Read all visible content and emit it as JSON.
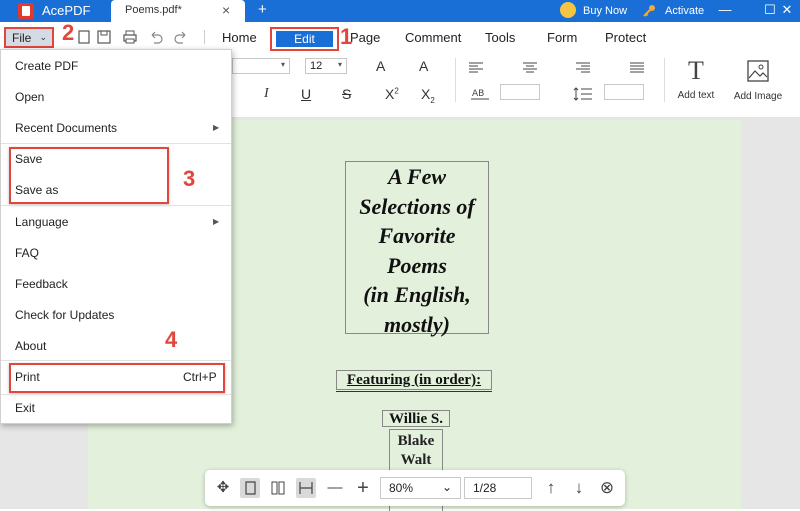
{
  "titlebar": {
    "app_name": "AcePDF",
    "doc_tab": "Poems.pdf*",
    "doc_tab_close": "×",
    "new_tab": "+",
    "buy_now": "Buy Now",
    "activate": "Activate",
    "minimize": "—",
    "maximize": "☐",
    "close": "✕",
    "colors": {
      "titlebar": "#1a6fd6",
      "annotation": "#e0463a"
    }
  },
  "menubar": {
    "file_label": "File",
    "file_caret": "⌄",
    "tabs": [
      "Home",
      "Edit",
      "Page",
      "Comment",
      "Tools",
      "Form",
      "Protect"
    ],
    "active_tab": "Edit",
    "quick_icons": [
      "new-doc-icon",
      "save-icon",
      "print-icon",
      "undo-icon",
      "redo-icon"
    ]
  },
  "annotations": [
    "1",
    "2",
    "3",
    "4"
  ],
  "toolbar": {
    "font_size": "12",
    "font_size_caret": "▾",
    "font_family_caret": "▾",
    "increase_font": "A",
    "decrease_font": "A",
    "italic": "I",
    "underline": "U",
    "strikethrough": "S",
    "superscript": "X",
    "subscript": "X",
    "superscript_mark": "2",
    "subscript_mark": "2",
    "add_text": "Add text",
    "add_image": "Add Image",
    "add_text_glyph": "T"
  },
  "file_menu": {
    "items": [
      {
        "label": "Create PDF"
      },
      {
        "label": "Open"
      },
      {
        "label": "Recent Documents",
        "submenu": true
      },
      {
        "label": "Save"
      },
      {
        "label": "Save as"
      },
      {
        "label": "Language",
        "submenu": true
      },
      {
        "label": "FAQ"
      },
      {
        "label": "Feedback"
      },
      {
        "label": "Check for Updates"
      },
      {
        "label": "About"
      },
      {
        "label": "Print",
        "shortcut": "Ctrl+P"
      },
      {
        "label": "Exit"
      }
    ],
    "submenu_arrow": "▶"
  },
  "document": {
    "title_lines": [
      "A Few",
      "Selections of",
      "Favorite",
      "Poems",
      "(in English,",
      "mostly)"
    ],
    "featuring": "Featuring (in order):",
    "names": [
      "Willie S.",
      "Blake",
      "Walt"
    ]
  },
  "zoombar": {
    "zoom": "80%",
    "zoom_caret": "⌄",
    "page": "1/28",
    "zoom_out": "—",
    "zoom_in": "+",
    "prev": "↑",
    "next": "↓",
    "close": "⊗",
    "move": "✥"
  }
}
